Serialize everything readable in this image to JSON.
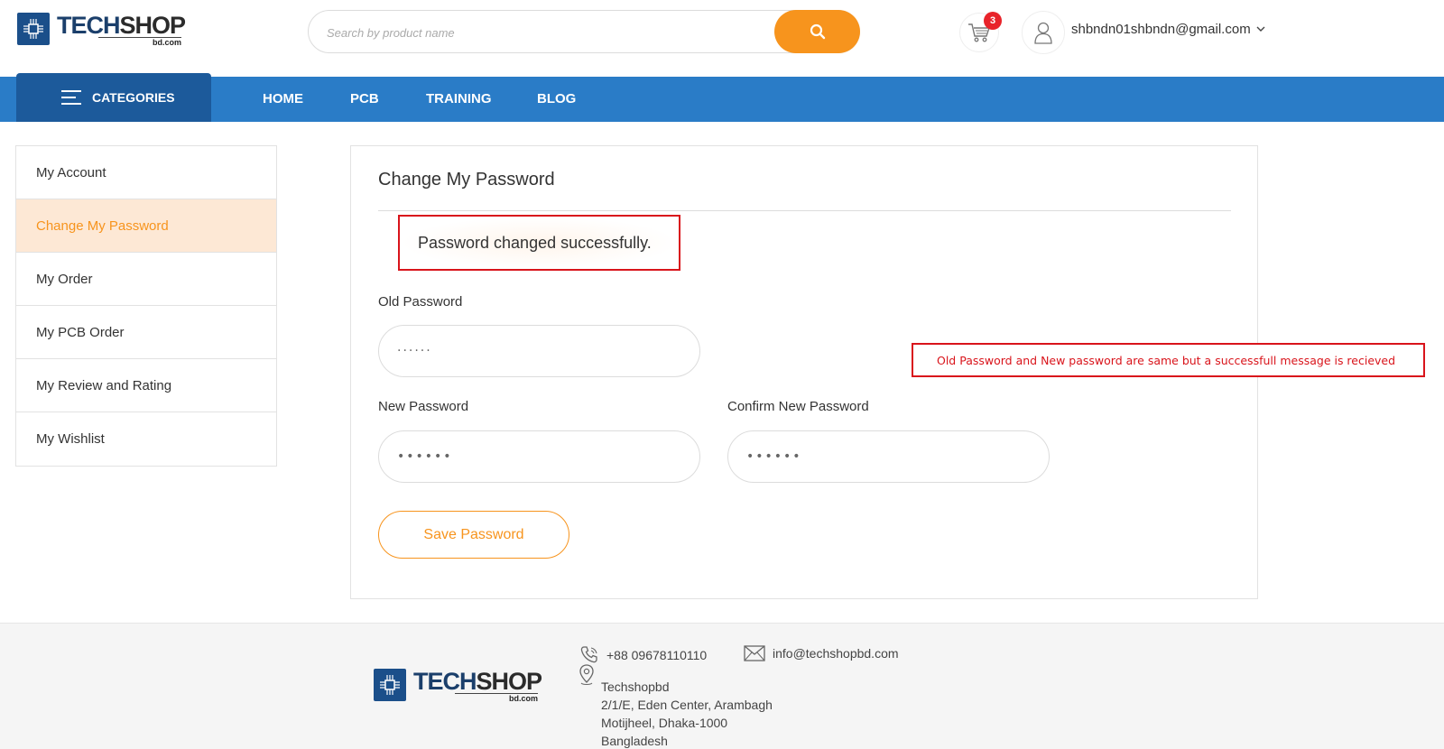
{
  "header": {
    "logo": {
      "word_a": "TECH",
      "word_b": "SHOP",
      "sub": "bd.com"
    },
    "search": {
      "placeholder": "Search by product name"
    },
    "cart": {
      "count": "3"
    },
    "user": {
      "email": "shbndn01shbndn@gmail.com"
    }
  },
  "nav": {
    "categories_label": "CATEGORIES",
    "links": [
      "HOME",
      "PCB",
      "TRAINING",
      "BLOG"
    ]
  },
  "sidebar": {
    "items": [
      {
        "label": "My Account",
        "active": false
      },
      {
        "label": "Change My Password",
        "active": true
      },
      {
        "label": "My Order",
        "active": false
      },
      {
        "label": "My PCB Order",
        "active": false
      },
      {
        "label": "My Review and Rating",
        "active": false
      },
      {
        "label": "My Wishlist",
        "active": false
      }
    ]
  },
  "main": {
    "title": "Change My Password",
    "success_message": "Password changed successfully.",
    "old_password": {
      "label": "Old Password",
      "value": "······"
    },
    "new_password": {
      "label": "New Password",
      "value": "••••••"
    },
    "confirm_password": {
      "label": "Confirm New Password",
      "value": "••••••"
    },
    "save_label": "Save Password"
  },
  "annotation": {
    "text": "Old Password and New password are same but  a successfull message is recieved"
  },
  "footer": {
    "phone": "+88 09678110110",
    "email": "info@techshopbd.com",
    "address_lines": [
      "Techshopbd",
      "2/1/E, Eden Center, Arambagh",
      "Motijheel, Dhaka-1000",
      "Bangladesh"
    ]
  },
  "colors": {
    "brand_blue": "#2a7cc7",
    "brand_dark_blue": "#1c5a9b",
    "accent_orange": "#f7941d",
    "alert_red": "#d9141b"
  }
}
